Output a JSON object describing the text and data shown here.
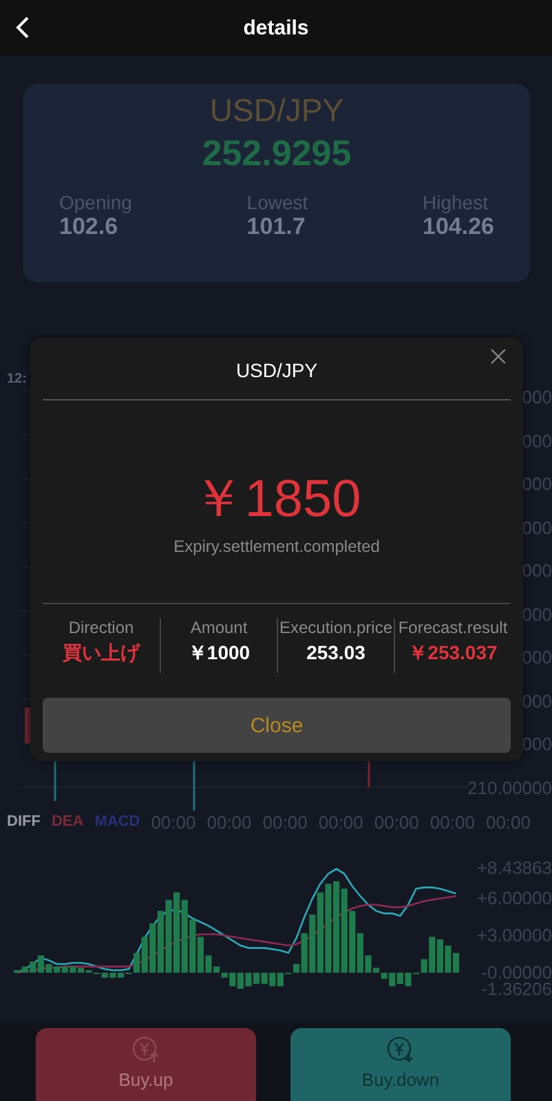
{
  "header": {
    "title": "details"
  },
  "summary": {
    "pair": "USD/JPY",
    "price": "252.9295",
    "stats": [
      {
        "label": "Opening",
        "value": "102.6"
      },
      {
        "label": "Lowest",
        "value": "101.7"
      },
      {
        "label": "Highest",
        "value": "104.26"
      }
    ]
  },
  "main_chart": {
    "time_label": "12:",
    "axis_labels": [
      "000",
      "000",
      "000",
      "000",
      "000",
      "000",
      "000",
      "000",
      "000",
      "210.00000"
    ]
  },
  "time_axis": {
    "times": [
      "00:00",
      "00:00",
      "00:00",
      "00:00",
      "00:00",
      "00:00",
      "00:00"
    ]
  },
  "macd_chart": {
    "chart_data": {
      "type": "bar",
      "ylim": [
        -1.36206,
        8.43863
      ],
      "yticks": [
        {
          "value": 8.43863,
          "label": "+8.43863"
        },
        {
          "value": 6,
          "label": "+6.00000"
        },
        {
          "value": 3,
          "label": "+3.00000"
        },
        {
          "value": 0,
          "label": "-0.00000"
        },
        {
          "value": -1.36206,
          "label": "-1.36206"
        }
      ],
      "series": [
        {
          "name": "DIFF",
          "type": "line",
          "color": "#2ba7b5",
          "values": [
            0,
            0.3,
            0.7,
            1.2,
            1.0,
            0.7,
            0.7,
            0.8,
            0.8,
            0.7,
            0.5,
            0.3,
            0.2,
            0.2,
            0.3,
            1.5,
            2.8,
            3.8,
            4.6,
            5.0,
            5.1,
            4.8,
            4.4,
            4.1,
            3.8,
            3.4,
            3.0,
            2.6,
            2.2,
            2.0,
            2.0,
            2.0,
            1.9,
            1.8,
            1.6,
            2.8,
            4.5,
            6.0,
            7.2,
            8.0,
            8.4,
            8.0,
            7.0,
            6.2,
            5.5,
            5.0,
            4.8,
            4.8,
            4.6,
            5.5,
            6.8,
            6.9,
            6.9,
            6.8,
            6.6,
            6.4
          ]
        },
        {
          "name": "DEA",
          "type": "line",
          "color": "#8a2a50",
          "values": [
            0,
            0.1,
            0.2,
            0.3,
            0.4,
            0.4,
            0.5,
            0.5,
            0.5,
            0.5,
            0.5,
            0.5,
            0.5,
            0.5,
            0.5,
            0.7,
            1.0,
            1.4,
            1.8,
            2.2,
            2.5,
            2.8,
            3.0,
            3.1,
            3.1,
            3.1,
            3.0,
            2.9,
            2.8,
            2.7,
            2.6,
            2.5,
            2.4,
            2.3,
            2.2,
            2.3,
            2.6,
            3.0,
            3.5,
            4.0,
            4.5,
            4.9,
            5.2,
            5.4,
            5.5,
            5.5,
            5.4,
            5.3,
            5.3,
            5.4,
            5.6,
            5.8,
            5.9,
            6.0,
            6.1,
            6.2
          ]
        },
        {
          "name": "MACD",
          "type": "bar",
          "color": "#1f7a4c",
          "values": [
            0.2,
            0.5,
            0.9,
            1.4,
            0.7,
            0.5,
            0.5,
            0.5,
            0.4,
            0.2,
            0,
            -0.4,
            -0.4,
            -0.4,
            0,
            1.6,
            2.9,
            4.0,
            5.0,
            5.9,
            6.5,
            5.9,
            4.3,
            2.9,
            1.4,
            0.5,
            -0.4,
            -1.1,
            -1.3,
            -1.1,
            -0.9,
            -0.9,
            -1.1,
            -1.1,
            0,
            0.7,
            3.2,
            4.7,
            6.5,
            7.2,
            7.4,
            6.8,
            5.0,
            3.2,
            1.4,
            0.4,
            -0.5,
            -1.1,
            -0.9,
            -1.1,
            0,
            1.1,
            2.9,
            2.7,
            2.2,
            1.6
          ]
        }
      ]
    }
  },
  "dialog": {
    "title": "USD/JPY",
    "amount": "￥1850",
    "status": "Expiry.settlement.completed",
    "details": [
      {
        "label": "Direction",
        "value": "買い上げ",
        "color": "#e0343c"
      },
      {
        "label": "Amount",
        "value": "￥1000",
        "color": "#ffffff"
      },
      {
        "label": "Execution.price",
        "value": "253.03",
        "color": "#ffffff"
      },
      {
        "label": "Forecast.result",
        "value": "￥253.037",
        "color": "#e0343c"
      }
    ],
    "button": "Close"
  },
  "actions": [
    {
      "label": "Buy.up",
      "kind": "up"
    },
    {
      "label": "Buy.down",
      "kind": "down"
    }
  ]
}
